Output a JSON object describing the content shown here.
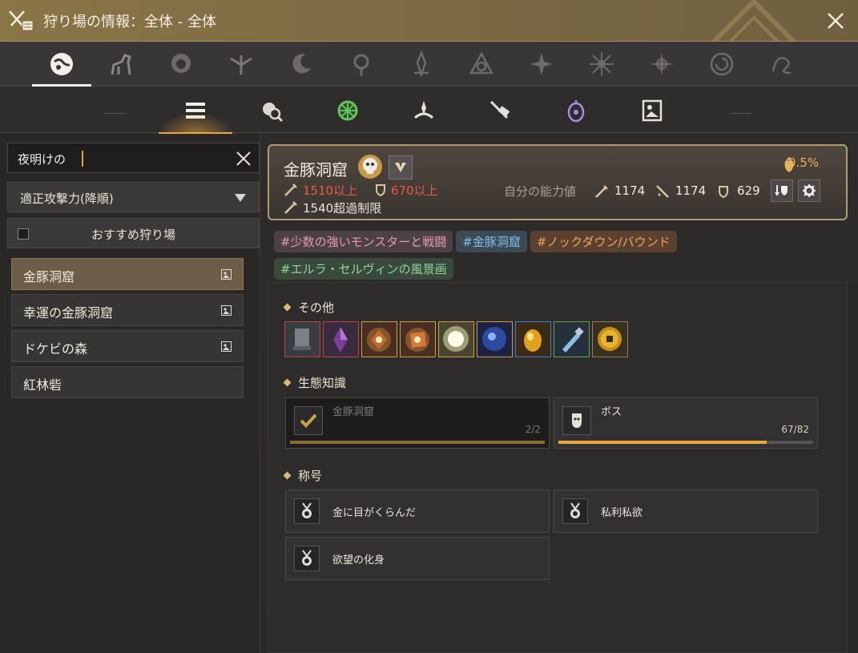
{
  "window": {
    "title": "狩り場の情報：全体 - 全体"
  },
  "colors": {
    "accent": "#e7a748",
    "titlebar": "#8a7547",
    "selected_item": "#6d5c47"
  },
  "categories": [
    {
      "icon": "all-globe-icon",
      "active": true
    },
    {
      "icon": "horse-icon"
    },
    {
      "icon": "lion-icon"
    },
    {
      "icon": "winged-crest-icon"
    },
    {
      "icon": "crescent-moon-icon"
    },
    {
      "icon": "sun-ornament-icon"
    },
    {
      "icon": "flame-crest-icon"
    },
    {
      "icon": "knot-crest-icon"
    },
    {
      "icon": "star-burst-icon"
    },
    {
      "icon": "snowflake-icon"
    },
    {
      "icon": "compass-star-icon"
    },
    {
      "icon": "spiral-ring-icon"
    },
    {
      "icon": "swirl-rune-icon"
    }
  ],
  "subtabs": [
    {
      "icon": "list-icon",
      "active": true
    },
    {
      "icon": "magnifier-head-icon"
    },
    {
      "icon": "green-gear-icon"
    },
    {
      "icon": "crown-flame-icon"
    },
    {
      "icon": "scroll-sword-icon"
    },
    {
      "icon": "purple-lantern-icon"
    },
    {
      "icon": "portrait-frame-icon"
    }
  ],
  "left": {
    "search_value": "夜明けの",
    "sort_label": "適正攻撃力(降順)",
    "recommended_label": "おすすめ狩り場",
    "locations": [
      {
        "label": "金豚洞窟",
        "selected": true,
        "has_icon": true
      },
      {
        "label": "幸運の金豚洞窟",
        "selected": false,
        "has_icon": true
      },
      {
        "label": "ドケビの森",
        "selected": false,
        "has_icon": true
      },
      {
        "label": "紅林砦",
        "selected": false,
        "has_icon": false
      }
    ]
  },
  "info": {
    "name": "金豚洞窟",
    "ap_required": "1510以上",
    "dp_required": "670以上",
    "ap_cap": "1540超過制限",
    "drop_bonus": "0.5%",
    "self_label": "自分の能力値",
    "self_ap": "1174",
    "self_aap": "1174",
    "self_dp": "629"
  },
  "tags": [
    {
      "text": "#少数の強いモンスターと戦闘",
      "style": "pink"
    },
    {
      "text": "#金豚洞窟",
      "style": "blue"
    },
    {
      "text": "#ノックダウン/バウンド",
      "style": "orange"
    },
    {
      "text": "#エルラ・セルヴィンの風景画",
      "style": "green"
    }
  ],
  "sections": {
    "other": "その他",
    "ecology": "生態知識",
    "titles": "称号"
  },
  "loot_items": [
    {
      "icon": "scroll-icon",
      "color": "#5a5f63",
      "border": "#b94545"
    },
    {
      "icon": "crystal-purple-icon",
      "color": "#7a3f9a",
      "border": "#b94545"
    },
    {
      "icon": "red-ore-icon",
      "color": "#c76a30",
      "border": "#c9a24a"
    },
    {
      "icon": "red-ore-icon",
      "color": "#d7773a",
      "border": "#c9a24a"
    },
    {
      "icon": "glowing-orb-icon",
      "color": "#e8e6c0",
      "border": "#c9a24a"
    },
    {
      "icon": "blue-orb-icon",
      "color": "#2c4aa0",
      "border": "#c9a24a"
    },
    {
      "icon": "gold-egg-icon",
      "color": "#e0a020",
      "border": "#4a7ad0"
    },
    {
      "icon": "potion-icon",
      "color": "#5a8ac8",
      "border": "#6aa04a"
    },
    {
      "icon": "gold-coin-icon",
      "color": "#c8901a",
      "border": "#8a7d6a"
    }
  ],
  "ecology": [
    {
      "name": "金豚洞窟",
      "count": "2/2",
      "progress": 1.0,
      "done": true
    },
    {
      "name": "ボス",
      "count": "67/82",
      "progress": 0.817,
      "done": false
    }
  ],
  "titles": [
    {
      "name": "金に目がくらんだ"
    },
    {
      "name": "私利私欲"
    },
    {
      "name": "欲望の化身"
    }
  ]
}
